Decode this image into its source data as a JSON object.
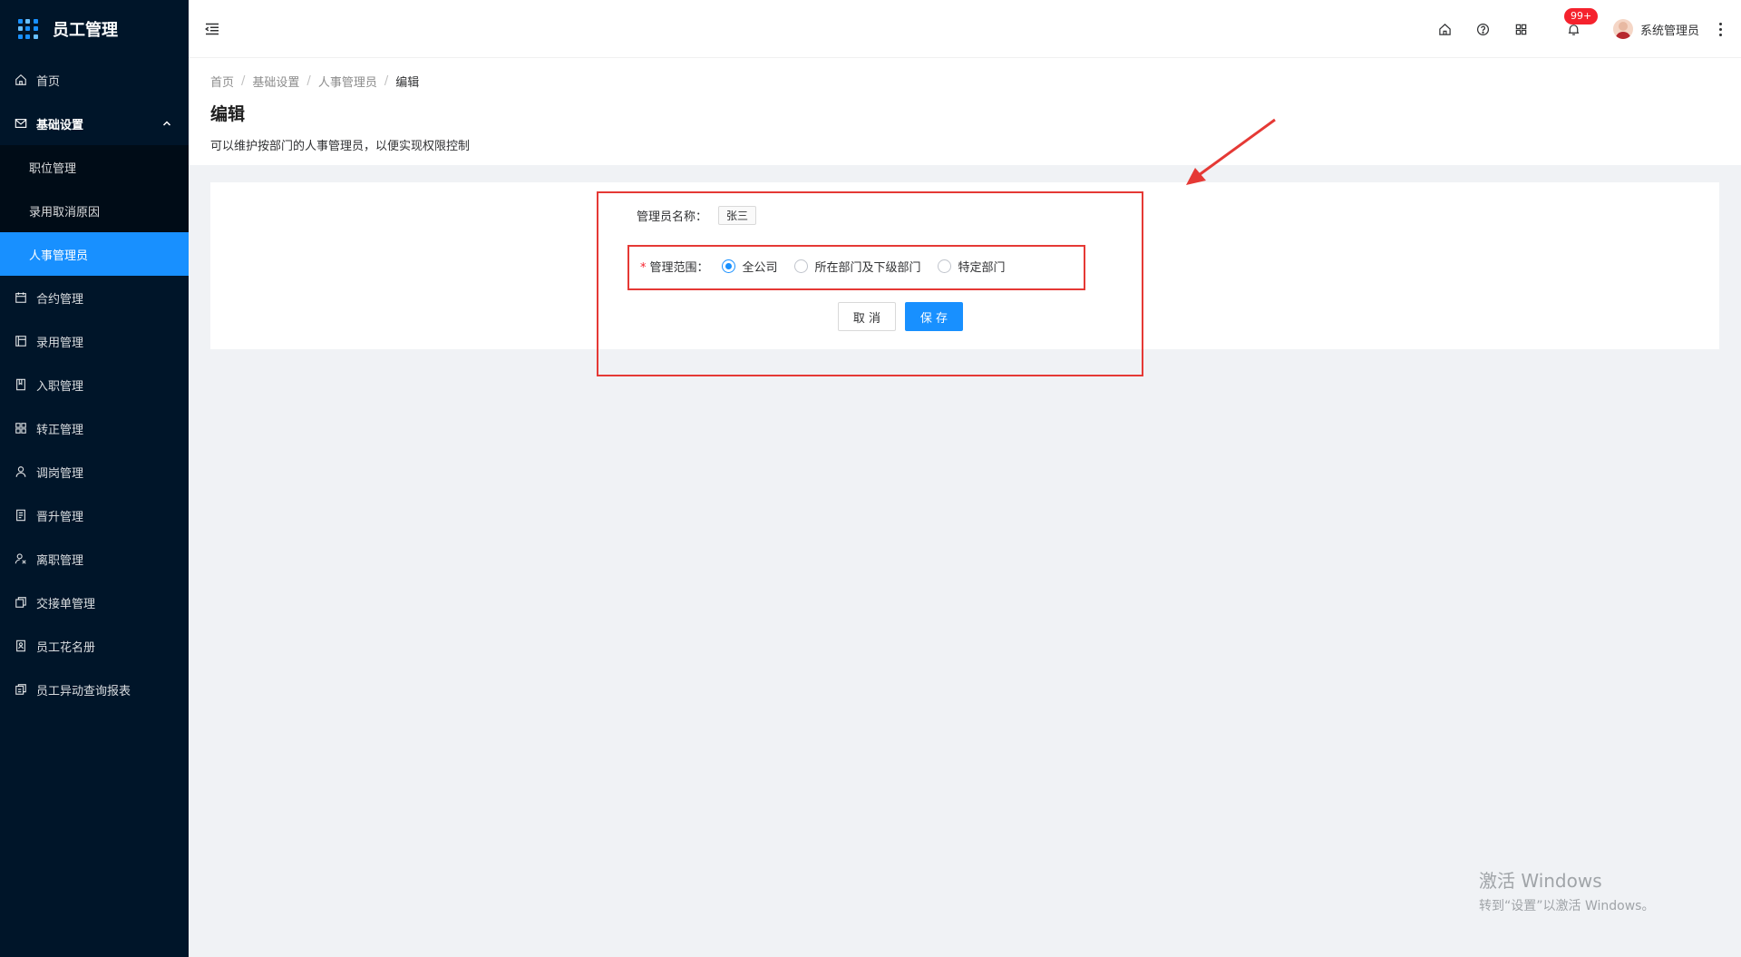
{
  "app": {
    "title": "员工管理"
  },
  "sidebar": {
    "items": [
      {
        "label": "首页",
        "icon": "home-icon"
      },
      {
        "label": "基础设置",
        "icon": "mail-icon",
        "open": true,
        "children": [
          {
            "label": "职位管理"
          },
          {
            "label": "录用取消原因"
          },
          {
            "label": "人事管理员",
            "active": true
          }
        ]
      },
      {
        "label": "合约管理",
        "icon": "calendar-icon"
      },
      {
        "label": "录用管理",
        "icon": "board-icon"
      },
      {
        "label": "入职管理",
        "icon": "book-icon"
      },
      {
        "label": "转正管理",
        "icon": "grid-icon"
      },
      {
        "label": "调岗管理",
        "icon": "user-icon"
      },
      {
        "label": "晋升管理",
        "icon": "doc-icon"
      },
      {
        "label": "离职管理",
        "icon": "leave-icon"
      },
      {
        "label": "交接单管理",
        "icon": "copy-icon"
      },
      {
        "label": "员工花名册",
        "icon": "roster-icon"
      },
      {
        "label": "员工异动查询报表",
        "icon": "report-icon"
      }
    ]
  },
  "header": {
    "notification_count": "99+",
    "user_name": "系统管理员"
  },
  "breadcrumb": [
    "首页",
    "基础设置",
    "人事管理员",
    "编辑"
  ],
  "page": {
    "title": "编辑",
    "description": "可以维护按部门的人事管理员，以便实现权限控制"
  },
  "form": {
    "name_label": "管理员名称：",
    "name_value": "张三",
    "scope_required_mark": "*",
    "scope_label": "管理范围：",
    "scope_options": [
      {
        "label": "全公司",
        "checked": true
      },
      {
        "label": "所在部门及下级部门",
        "checked": false
      },
      {
        "label": "特定部门",
        "checked": false
      }
    ],
    "cancel_label": "取 消",
    "save_label": "保 存"
  },
  "watermark": {
    "title": "激活 Windows",
    "subtitle": "转到“设置”以激活 Windows。"
  },
  "colors": {
    "sidebar_bg": "#001529",
    "submenu_bg": "#000c17",
    "primary": "#1890ff",
    "annotation_red": "#e53935"
  }
}
